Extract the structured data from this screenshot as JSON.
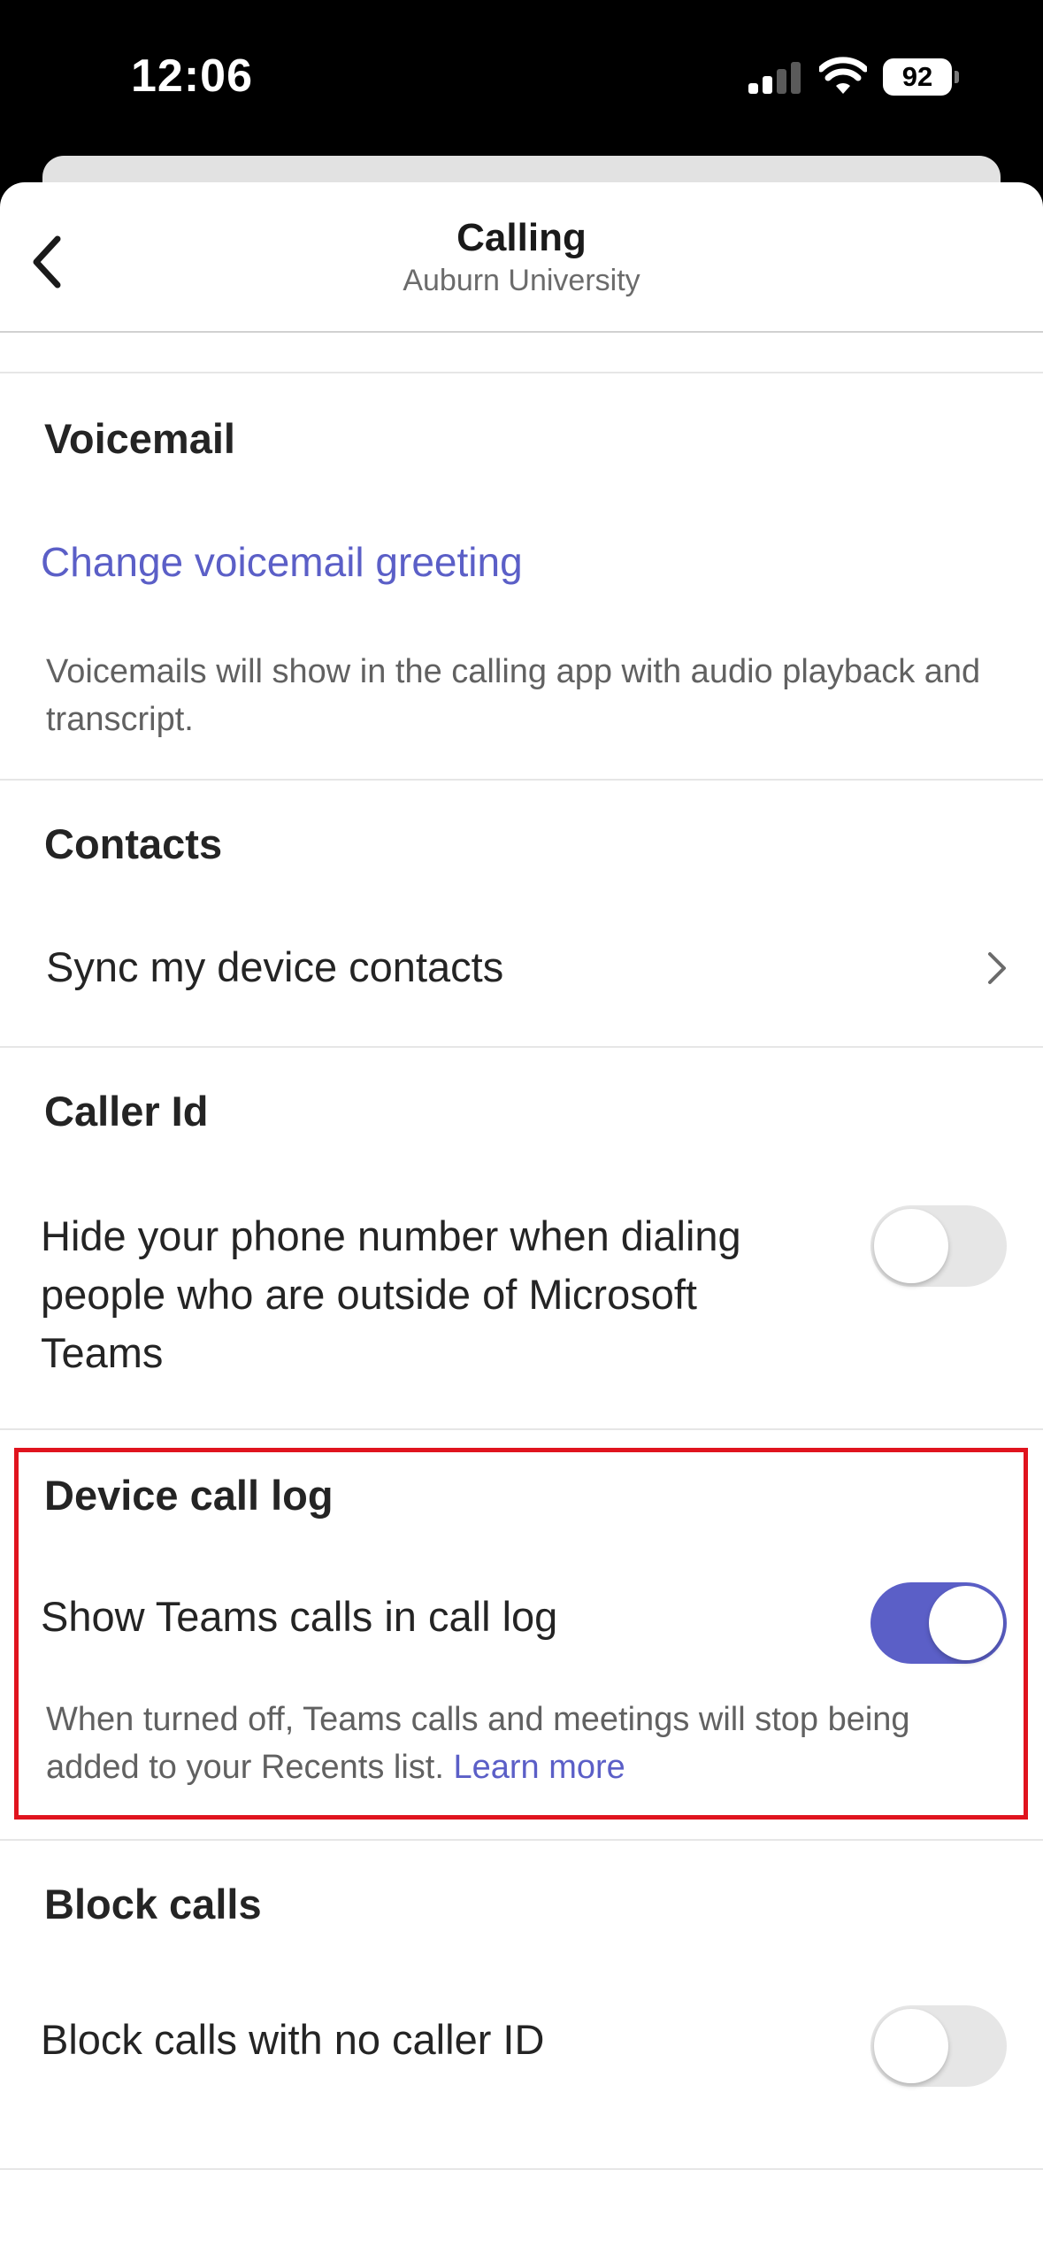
{
  "status_bar": {
    "time": "12:06",
    "battery": "92"
  },
  "header": {
    "title": "Calling",
    "subtitle": "Auburn University"
  },
  "voicemail": {
    "title": "Voicemail",
    "link": "Change voicemail greeting",
    "caption": "Voicemails will show in the calling app with audio playback and transcript."
  },
  "contacts": {
    "title": "Contacts",
    "row": "Sync my device contacts"
  },
  "caller_id": {
    "title": "Caller Id",
    "row": "Hide your phone number when dialing people who are outside of Microsoft Teams",
    "toggle_on": false
  },
  "device_call_log": {
    "title": "Device call log",
    "row": "Show Teams calls in call log",
    "toggle_on": true,
    "caption": "When turned off, Teams calls and meetings will stop being added to your Recents list.",
    "learn_more": "Learn more"
  },
  "block_calls": {
    "title": "Block calls",
    "row": "Block calls with no caller ID",
    "toggle_on": false
  },
  "colors": {
    "accent": "#5b5fc7",
    "highlight": "#e0141e"
  }
}
